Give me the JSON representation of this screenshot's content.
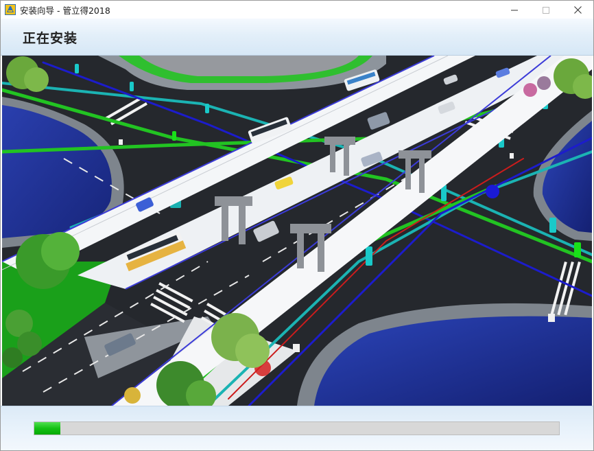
{
  "window": {
    "title": "安装向导 - 管立得2018",
    "app_icon": "app-logo-icon",
    "controls": {
      "minimize_icon": "minimize-icon",
      "maximize_icon": "maximize-icon",
      "close_icon": "close-icon"
    }
  },
  "header": {
    "title": "正在安装"
  },
  "illustration": {
    "icon": "road-pipeline-3d-illustration"
  },
  "progress": {
    "fraction": 0.05,
    "color": "#14c014"
  },
  "colors": {
    "header_bg": "#e3eff9",
    "footer_bg": "#e8f2fb",
    "pipe_green": "#22c322",
    "pipe_teal": "#1bb3b3",
    "pipe_blue": "#1c1ccc",
    "pipe_red": "#cc1c1c",
    "water": "#1e2f9a"
  }
}
